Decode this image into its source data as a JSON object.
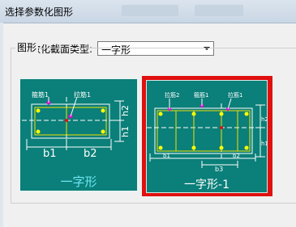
{
  "window": {
    "title": "选择参数化图形"
  },
  "section_type": {
    "label": "参数化截面类型:",
    "selected": "一字形"
  },
  "group": {
    "label": "图形"
  },
  "shapes": [
    {
      "caption": "一字形",
      "labels": {
        "stirrup": "箍筋1",
        "tie": "拉筋1",
        "b1": "b1",
        "b2": "b2",
        "h1": "h1",
        "h2": "h2"
      }
    },
    {
      "caption": "一字形-1",
      "labels": {
        "tie2": "拉筋2",
        "stirrup": "箍筋1",
        "tie1": "拉筋1",
        "b3": "b3",
        "h1": "h1",
        "h2": "h2",
        "b1": "b1",
        "b2": "b2"
      }
    }
  ],
  "colors": {
    "thumb_bg": "#0b7f79",
    "selection": "#e01010",
    "caption1": "#6fe6f5"
  }
}
